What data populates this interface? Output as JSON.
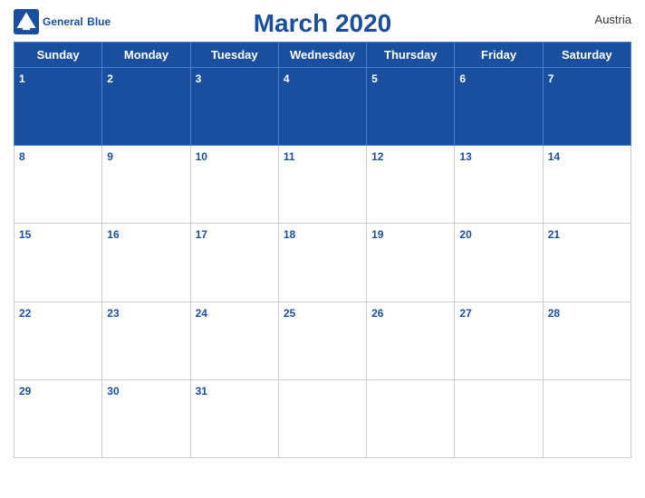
{
  "header": {
    "logo_text_line1": "General",
    "logo_text_line2": "Blue",
    "title": "March 2020",
    "country": "Austria"
  },
  "weekdays": [
    "Sunday",
    "Monday",
    "Tuesday",
    "Wednesday",
    "Thursday",
    "Friday",
    "Saturday"
  ],
  "weeks": [
    [
      {
        "day": 1,
        "empty": false
      },
      {
        "day": 2,
        "empty": false
      },
      {
        "day": 3,
        "empty": false
      },
      {
        "day": 4,
        "empty": false
      },
      {
        "day": 5,
        "empty": false
      },
      {
        "day": 6,
        "empty": false
      },
      {
        "day": 7,
        "empty": false
      }
    ],
    [
      {
        "day": 8,
        "empty": false
      },
      {
        "day": 9,
        "empty": false
      },
      {
        "day": 10,
        "empty": false
      },
      {
        "day": 11,
        "empty": false
      },
      {
        "day": 12,
        "empty": false
      },
      {
        "day": 13,
        "empty": false
      },
      {
        "day": 14,
        "empty": false
      }
    ],
    [
      {
        "day": 15,
        "empty": false
      },
      {
        "day": 16,
        "empty": false
      },
      {
        "day": 17,
        "empty": false
      },
      {
        "day": 18,
        "empty": false
      },
      {
        "day": 19,
        "empty": false
      },
      {
        "day": 20,
        "empty": false
      },
      {
        "day": 21,
        "empty": false
      }
    ],
    [
      {
        "day": 22,
        "empty": false
      },
      {
        "day": 23,
        "empty": false
      },
      {
        "day": 24,
        "empty": false
      },
      {
        "day": 25,
        "empty": false
      },
      {
        "day": 26,
        "empty": false
      },
      {
        "day": 27,
        "empty": false
      },
      {
        "day": 28,
        "empty": false
      }
    ],
    [
      {
        "day": 29,
        "empty": false
      },
      {
        "day": 30,
        "empty": false
      },
      {
        "day": 31,
        "empty": false
      },
      {
        "day": null,
        "empty": true
      },
      {
        "day": null,
        "empty": true
      },
      {
        "day": null,
        "empty": true
      },
      {
        "day": null,
        "empty": true
      }
    ]
  ],
  "colors": {
    "header_bg": "#1a4fa0",
    "header_text": "#ffffff",
    "title_color": "#1a4fa0",
    "day_number_color": "#1a4fa0",
    "row_header_day_color": "#ffffff"
  }
}
